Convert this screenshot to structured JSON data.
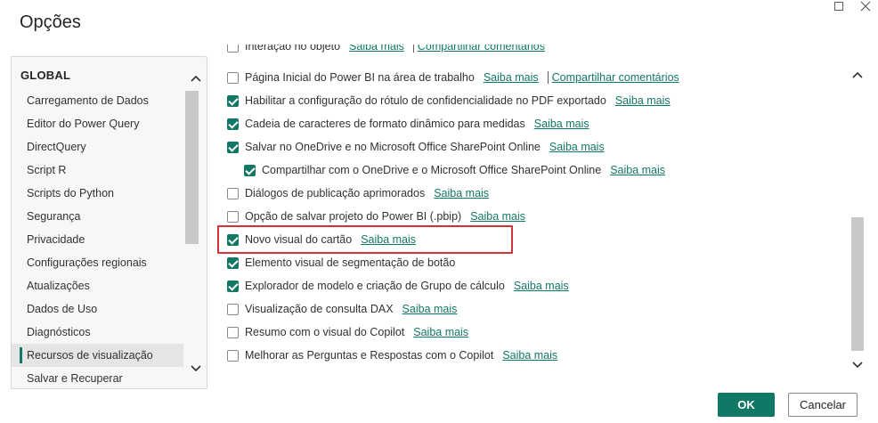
{
  "dialog": {
    "title": "Opções",
    "window_controls": {
      "maximize_icon": "maximize-icon",
      "close_icon": "close-icon"
    }
  },
  "nav": {
    "header": "GLOBAL",
    "items": [
      {
        "label": "Carregamento de Dados",
        "selected": false
      },
      {
        "label": "Editor do Power Query",
        "selected": false
      },
      {
        "label": "DirectQuery",
        "selected": false
      },
      {
        "label": "Script R",
        "selected": false
      },
      {
        "label": "Scripts do Python",
        "selected": false
      },
      {
        "label": "Segurança",
        "selected": false
      },
      {
        "label": "Privacidade",
        "selected": false
      },
      {
        "label": "Configurações regionais",
        "selected": false
      },
      {
        "label": "Atualizações",
        "selected": false
      },
      {
        "label": "Dados de Uso",
        "selected": false
      },
      {
        "label": "Diagnósticos",
        "selected": false
      },
      {
        "label": "Recursos de visualização",
        "selected": true
      },
      {
        "label": "Salvar e Recuperar",
        "selected": false
      }
    ]
  },
  "options": [
    {
      "label": "Interação no objeto",
      "checked": false,
      "link": "Saiba mais",
      "extra_link": "Compartilhar comentários",
      "indent": false,
      "clipped": true
    },
    {
      "label": "Página Inicial do Power BI na área de trabalho",
      "checked": false,
      "link": "Saiba mais",
      "extra_link": "Compartilhar comentários",
      "indent": false
    },
    {
      "label": "Habilitar a configuração do rótulo de confidencialidade no PDF exportado",
      "checked": true,
      "link": "Saiba mais",
      "indent": false
    },
    {
      "label": "Cadeia de caracteres de formato dinâmico para medidas",
      "checked": true,
      "link": "Saiba mais",
      "indent": false
    },
    {
      "label": "Salvar no OneDrive e no Microsoft Office SharePoint Online",
      "checked": true,
      "link": "Saiba mais",
      "indent": false
    },
    {
      "label": "Compartilhar com o OneDrive e o Microsoft Office SharePoint Online",
      "checked": true,
      "link": "Saiba mais",
      "indent": true
    },
    {
      "label": "Diálogos de publicação aprimorados",
      "checked": false,
      "link": "Saiba mais",
      "indent": false
    },
    {
      "label": "Opção de salvar projeto do Power BI (.pbip)",
      "checked": false,
      "link": "Saiba mais",
      "indent": false
    },
    {
      "label": "Novo visual do cartão",
      "checked": true,
      "link": "Saiba mais",
      "indent": false,
      "highlighted": true
    },
    {
      "label": "Elemento visual de segmentação de botão",
      "checked": true,
      "indent": false
    },
    {
      "label": "Explorador de modelo e criação de Grupo de cálculo",
      "checked": true,
      "link": "Saiba mais",
      "indent": false
    },
    {
      "label": "Visualização de consulta DAX",
      "checked": false,
      "link": "Saiba mais",
      "indent": false
    },
    {
      "label": "Resumo com o visual do Copilot",
      "checked": false,
      "link": "Saiba mais",
      "indent": false
    },
    {
      "label": "Melhorar as Perguntas e Respostas com o Copilot",
      "checked": false,
      "link": "Saiba mais",
      "indent": false
    }
  ],
  "footer": {
    "ok_label": "OK",
    "cancel_label": "Cancelar"
  },
  "colors": {
    "accent": "#117865",
    "highlight_border": "#d13438"
  }
}
